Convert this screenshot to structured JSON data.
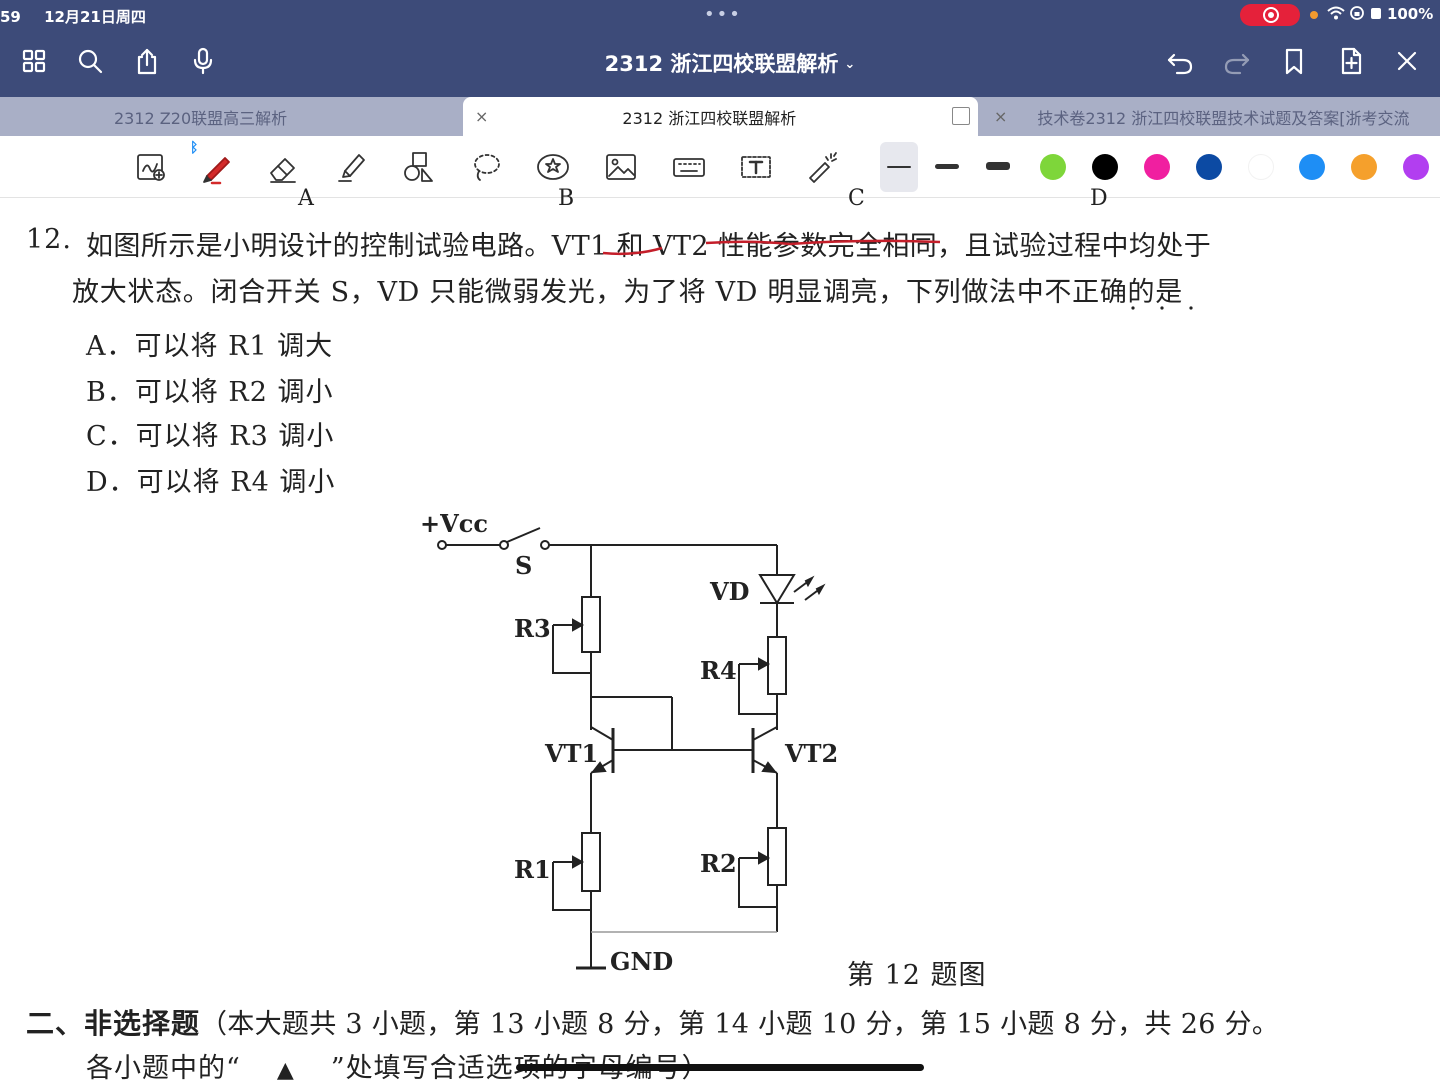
{
  "status_bar": {
    "time": "59",
    "date": "12月21日周四",
    "battery": "100%",
    "dots": "•••"
  },
  "toolbar_top": {
    "title": "2312 浙江四校联盟解析",
    "chevron": "⌄",
    "icons": [
      "grid-icon",
      "search-icon",
      "share-icon",
      "mic-icon",
      "undo-icon",
      "redo-icon",
      "bookmark-icon",
      "add-page-icon",
      "close-icon"
    ]
  },
  "tabs": [
    {
      "label": "2312 Z20联盟高三解析",
      "active": false
    },
    {
      "label": "2312 浙江四校联盟解析",
      "active": true,
      "close": "×"
    },
    {
      "label": "技术卷2312 浙江四校联盟技术试题及答案[浙考交流",
      "active": false,
      "close": "×"
    }
  ],
  "tools": {
    "names": [
      "lasso-zoom-icon",
      "pen-icon",
      "eraser-icon",
      "highlighter-icon",
      "shapes-icon",
      "lasso-icon",
      "sticker-icon",
      "image-icon",
      "keyboard-icon",
      "textbox-icon",
      "laser-icon"
    ],
    "bluetooth": "ᛒ",
    "colors": [
      "#7ed63a",
      "#000000",
      "#f01fa0",
      "#0c4aa3",
      "#ffffff",
      "#1e8ef5",
      "#f5a02c",
      "#b23ef0"
    ]
  },
  "document": {
    "top_letters": [
      "A",
      "B",
      "C",
      "D"
    ],
    "q_number": "12.",
    "q_line1": "如图所示是小明设计的控制试验电路。VT1 和 VT2 性能参数完全相同，且试验过程中均处于",
    "q_line2": "放大状态。闭合开关 S，VD 只能微弱发光，为了将 VD 明显调亮，下列做法中不正确的是",
    "options": [
      {
        "label": "A．",
        "text": "可以将 R1 调大"
      },
      {
        "label": "B．",
        "text": "可以将 R2 调小"
      },
      {
        "label": "C．",
        "text": "可以将 R3 调小"
      },
      {
        "label": "D．",
        "text": "可以将 R4 调小"
      }
    ],
    "circuit_labels": {
      "vcc": "+Vcc",
      "switch": "S",
      "led": "VD",
      "r1": "R1",
      "r2": "R2",
      "r3": "R3",
      "r4": "R4",
      "vt1": "VT1",
      "vt2": "VT2",
      "gnd": "GND"
    },
    "figure_caption": "第 12 题图",
    "section_heading": "二、非选择题",
    "section_line1": "（本大题共 3 小题，第 13 小题 8 分，第 14 小题 10 分，第 15 小题 8 分，共 26 分。",
    "section_line2_pre": "各小题中的“",
    "section_line2_mark": "▲",
    "section_line2_post": "”处填写合适选项的字母编号）"
  }
}
